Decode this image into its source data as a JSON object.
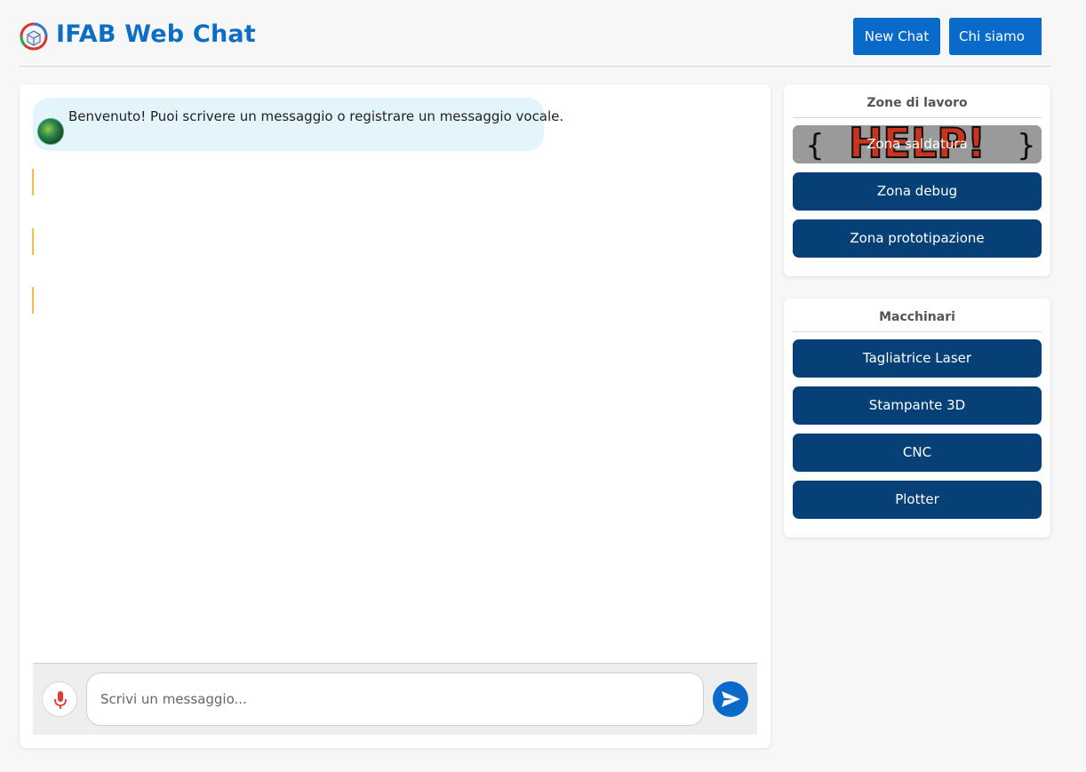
{
  "header": {
    "title": "IFAB Web Chat",
    "new_chat_label": "New Chat",
    "chi_siamo_label": "Chi siamo",
    "accent_color": "#0a6ac9"
  },
  "chat": {
    "messages": [
      {
        "sender": "bot",
        "text": "Benvenuto! Puoi scrivere un messaggio o registrare un messaggio vocale."
      }
    ],
    "input": {
      "placeholder": "Scrivi un messaggio...",
      "value": ""
    },
    "mic_icon": "microphone-icon",
    "send_icon": "send-icon"
  },
  "sidebar": {
    "zones": {
      "title": "Zone di lavoro",
      "items": [
        {
          "label": "Zona saldatura",
          "image_text": "HELP!"
        },
        {
          "label": "Zona debug"
        },
        {
          "label": "Zona prototipazione"
        }
      ]
    },
    "machines": {
      "title": "Macchinari",
      "items": [
        {
          "label": "Tagliatrice Laser"
        },
        {
          "label": "Stampante 3D"
        },
        {
          "label": "CNC"
        },
        {
          "label": "Plotter"
        }
      ]
    },
    "button_color": "#064077"
  }
}
